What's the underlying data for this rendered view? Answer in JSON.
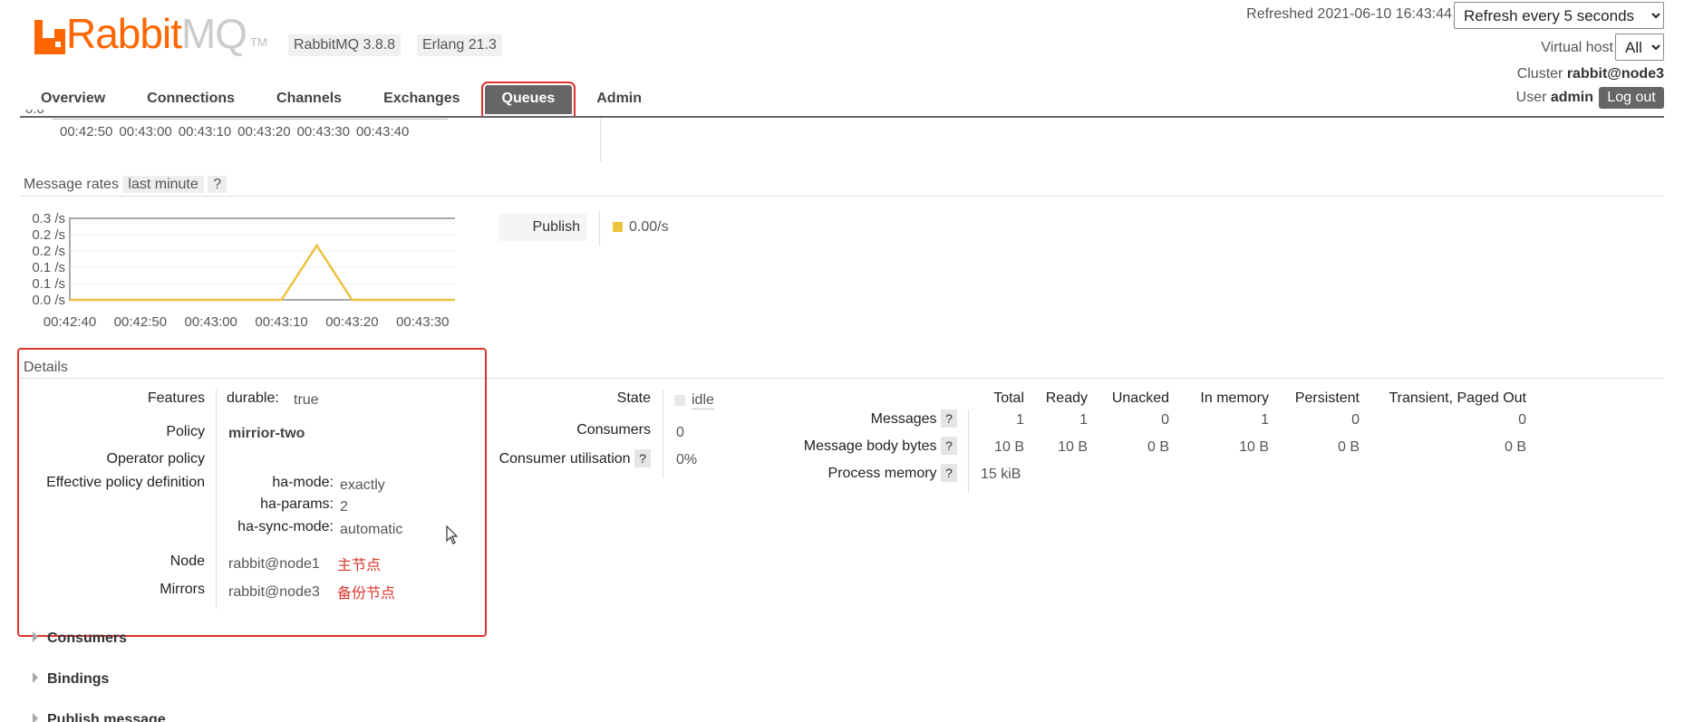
{
  "header": {
    "logo_rabbit": "Rabbit",
    "logo_mq": "MQ",
    "logo_tm": "TM",
    "version": "RabbitMQ 3.8.8",
    "erlang": "Erlang 21.3",
    "refreshed_label": "Refreshed",
    "refreshed_time": "2021-06-10 16:43:44",
    "refresh_option": "Refresh every 5 seconds",
    "vhost_label": "Virtual host",
    "vhost_value": "All",
    "cluster_label": "Cluster",
    "cluster_value": "rabbit@node3",
    "user_label": "User",
    "user_value": "admin",
    "logout_label": "Log out"
  },
  "nav": {
    "tabs": [
      {
        "label": "Overview"
      },
      {
        "label": "Connections"
      },
      {
        "label": "Channels"
      },
      {
        "label": "Exchanges"
      },
      {
        "label": "Queues",
        "active": true
      },
      {
        "label": "Admin"
      }
    ]
  },
  "queued_chart": {
    "y_tick_partial": "0.0",
    "x_ticks": [
      "00:42:50",
      "00:43:00",
      "00:43:10",
      "00:43:20",
      "00:43:30",
      "00:43:40"
    ]
  },
  "message_rates": {
    "label": "Message rates",
    "period": "last minute",
    "help": "?",
    "legend_label": "Publish",
    "legend_value": "0.00/s",
    "legend_color": "#edc240"
  },
  "chart_data": {
    "type": "line",
    "x": [
      "00:42:40",
      "00:42:50",
      "00:43:00",
      "00:43:10",
      "00:43:20",
      "00:43:30"
    ],
    "y_ticks": [
      "0.3 /s",
      "0.2 /s",
      "0.2 /s",
      "0.1 /s",
      "0.1 /s",
      "0.0 /s"
    ],
    "ylim": [
      0,
      0.3
    ],
    "series": [
      {
        "name": "Publish",
        "color": "#edc240",
        "points": [
          {
            "t": 0,
            "v": 0
          },
          {
            "t": 30,
            "v": 0
          },
          {
            "t": 35,
            "v": 0.2
          },
          {
            "t": 40,
            "v": 0
          },
          {
            "t": 56,
            "v": 0
          }
        ]
      }
    ],
    "x_range_seconds": [
      0,
      56
    ],
    "grid": true
  },
  "details": {
    "title": "Details",
    "features_label": "Features",
    "durable_key": "durable:",
    "durable_value": "true",
    "policy_label": "Policy",
    "policy_value": "mirrior-two",
    "operator_policy_label": "Operator policy",
    "effective_label": "Effective policy definition",
    "ha_mode_key": "ha-mode:",
    "ha_mode_value": "exactly",
    "ha_params_key": "ha-params:",
    "ha_params_value": "2",
    "ha_sync_key": "ha-sync-mode:",
    "ha_sync_value": "automatic",
    "node_label": "Node",
    "node_value": "rabbit@node1",
    "node_note": "主节点",
    "mirrors_label": "Mirrors",
    "mirrors_value": "rabbit@node3",
    "mirrors_note": "备份节点",
    "state_label": "State",
    "state_value": "idle",
    "consumers_label": "Consumers",
    "consumers_value": "0",
    "consumer_util_label": "Consumer utilisation",
    "consumer_util_value": "0%",
    "help": "?"
  },
  "stats": {
    "headers": [
      "Total",
      "Ready",
      "Unacked",
      "In memory",
      "Persistent",
      "Transient, Paged Out"
    ],
    "rows": [
      {
        "label": "Messages",
        "values": [
          "1",
          "1",
          "0",
          "1",
          "0",
          "0"
        ]
      },
      {
        "label": "Message body bytes",
        "values": [
          "10 B",
          "10 B",
          "0 B",
          "10 B",
          "0 B",
          "0 B"
        ]
      }
    ],
    "process_memory_label": "Process memory",
    "process_memory_value": "15 kiB"
  },
  "sections": {
    "consumers": "Consumers",
    "bindings": "Bindings",
    "publish": "Publish message"
  }
}
